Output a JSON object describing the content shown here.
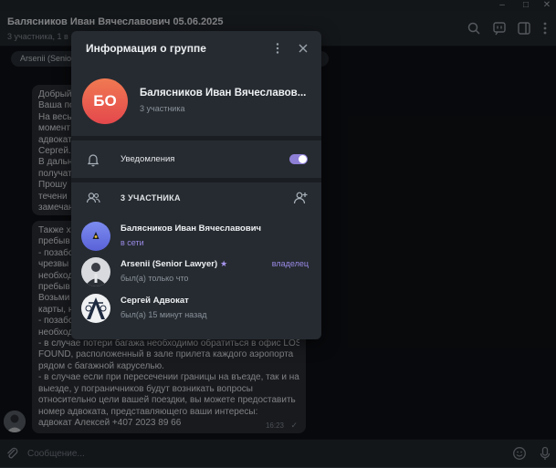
{
  "window": {
    "minimize": "–",
    "maximize": "□",
    "close": "✕"
  },
  "header": {
    "title": "Балясников Иван Вячеславович 05.06.2025",
    "subtitle": "3 участника, 1 в"
  },
  "pinned": {
    "label": "Arsenii (Senio"
  },
  "message": {
    "lines_top": [
      "Добрый",
      "Ваша по",
      "На весь",
      "момент",
      "адвокат",
      "Сергей.",
      "В дальн",
      "получат",
      "Прошу",
      "течени",
      "замечан"
    ],
    "lines_bottom": [
      "Также х",
      "пребыв",
      "- позабо",
      "чрезвы",
      "необход",
      "пребыв",
      "Возьми",
      "карты, н",
      "- позабо",
      "необход",
      "- в случае потери багажа необходимо обратиться в офис LOST &",
      "FOUND, расположенный в зале прилета каждого аэропорта",
      "рядом с багажной каруселью.",
      "- в случае если при пересечении границы на въезде, так и на",
      "выезде, у пограничников будут возникать вопросы",
      "относительно цели вашей поездки, вы можете предоставить",
      "номер адвоката, представляющего ваши интересы:",
      "адвокат Алексей +407 2023 89 66"
    ],
    "time": "16:23",
    "check": "✓"
  },
  "compose": {
    "placeholder": "Сообщение..."
  },
  "modal": {
    "title": "Информация о группе",
    "group_initials": "БО",
    "group_name": "Балясников Иван Вячеславов...",
    "group_count": "3 участника",
    "notifications_label": "Уведомления",
    "notifications_on": true,
    "members_label": "3 УЧАСТНИКА",
    "members": [
      {
        "name": "Балясников Иван Вячеславович",
        "status": "в сети",
        "role": ""
      },
      {
        "name": "Arsenii (Senior Lawyer)",
        "status": "был(а) только что",
        "role": "владелец"
      },
      {
        "name": "Сергей Адвокат",
        "status": "был(а) 15 минут назад",
        "role": ""
      }
    ]
  },
  "colors": {
    "accent": "#9a8ae6",
    "avatar_gradient_top": "#f07a52",
    "avatar_gradient_bottom": "#e4484c"
  },
  "icons": [
    "search-icon",
    "live-stream-icon",
    "sidebar-toggle-icon",
    "more-vertical-icon",
    "attach-icon",
    "emoji-icon",
    "mic-icon",
    "bell-icon",
    "users-icon",
    "add-user-icon",
    "close-icon",
    "star-icon"
  ]
}
